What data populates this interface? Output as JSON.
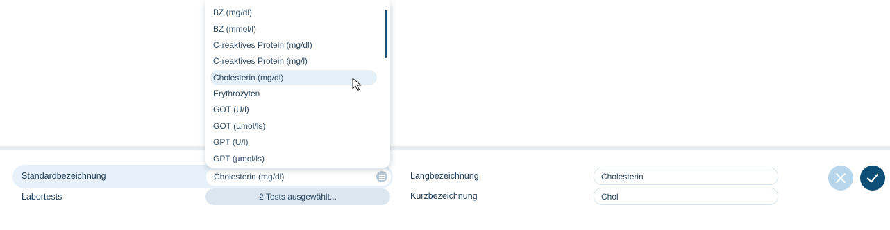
{
  "dropdown": {
    "items": [
      {
        "label": "BZ (mg/dl)"
      },
      {
        "label": "BZ (mmol/l)"
      },
      {
        "label": "C-reaktives Protein (mg/dl)"
      },
      {
        "label": "C-reaktives Protein (mg/l)"
      },
      {
        "label": "Cholesterin (mg/dl)",
        "selected": true
      },
      {
        "label": "Erythrozyten"
      },
      {
        "label": "GOT (U/l)"
      },
      {
        "label": "GOT (µmol/ls)"
      },
      {
        "label": "GPT (U/l)"
      },
      {
        "label": "GPT (µmol/ls)"
      }
    ]
  },
  "form": {
    "standard_label": "Standardbezeichnung",
    "standard_value": "Cholesterin (mg/dl)",
    "labortests_label": "Labortests",
    "labortests_button": "2 Tests ausgewählt...",
    "lang_label": "Langbezeichnung",
    "lang_value": "Cholesterin",
    "kurz_label": "Kurzbezeichnung",
    "kurz_value": "Chol"
  },
  "icons": {
    "cancel": "close-icon",
    "confirm": "check-icon",
    "select": "list-icon"
  },
  "colors": {
    "accent": "#0e4d75",
    "cancel_bg": "#b7d6ec",
    "highlight": "#e8f1f9"
  }
}
